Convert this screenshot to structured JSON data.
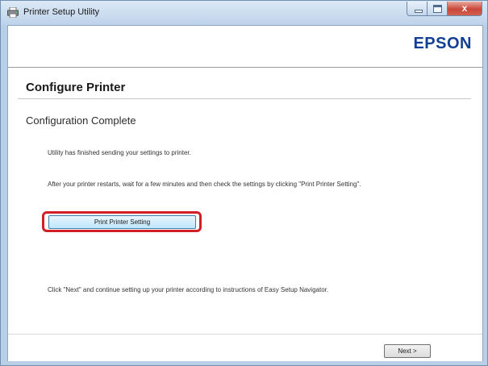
{
  "window": {
    "title": "Printer Setup Utility",
    "app_icon": "printer-setup-icon",
    "close_glyph": "x"
  },
  "brand": {
    "logo_text": "EPSON",
    "logo_color": "#123f93"
  },
  "main": {
    "heading": "Configure Printer",
    "subheading": "Configuration Complete",
    "message_1": "Utility has finished sending your settings to printer.",
    "message_2": "After your printer restarts, wait for a few minutes and then check the settings by clicking \"Print Printer Setting\".",
    "print_button_label": "Print Printer Setting",
    "message_3": "Click \"Next\" and continue setting up your printer according to instructions of Easy Setup Navigator.",
    "highlight_color": "#d21f26"
  },
  "footer": {
    "next_label": "Next >"
  }
}
